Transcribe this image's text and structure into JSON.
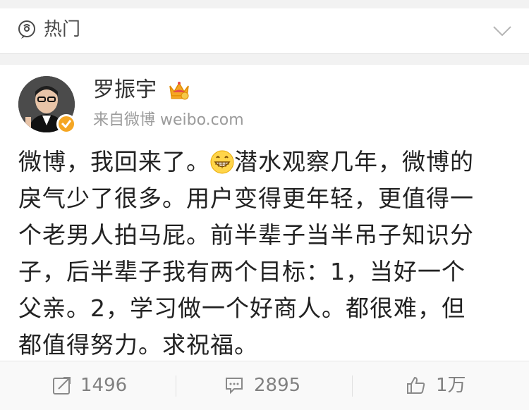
{
  "hotbar": {
    "label": "热门",
    "icon": "hot-topic-icon",
    "chevron_icon": "chevron-down-icon"
  },
  "post": {
    "author": "罗振宇",
    "author_badge_icon": "crown-icon",
    "verified_icon": "verified-badge-icon",
    "source": "来自微博 weibo.com",
    "text_before_emoji": "微博，我回来了。",
    "emoji_icon": "grin-emoji-icon",
    "text_after_emoji": "潜水观察几年，微博的\n戾气少了很多。用户变得更年轻，更值得一\n个老男人拍马屁。前半辈子当半吊子知识分\n子，后半辈子我有两个目标：1，当好一个\n父亲。2，学习做一个好商人。都很难，但\n都值得努力。求祝福。"
  },
  "actions": {
    "repost": {
      "icon": "repost-icon",
      "count": "1496"
    },
    "comment": {
      "icon": "comment-icon",
      "count": "2895"
    },
    "like": {
      "icon": "thumbs-up-icon",
      "count": "1万"
    }
  },
  "colors": {
    "text": "#222222",
    "muted": "#9b9b9b",
    "verified": "#f5a623",
    "crown": "#f5a623"
  }
}
